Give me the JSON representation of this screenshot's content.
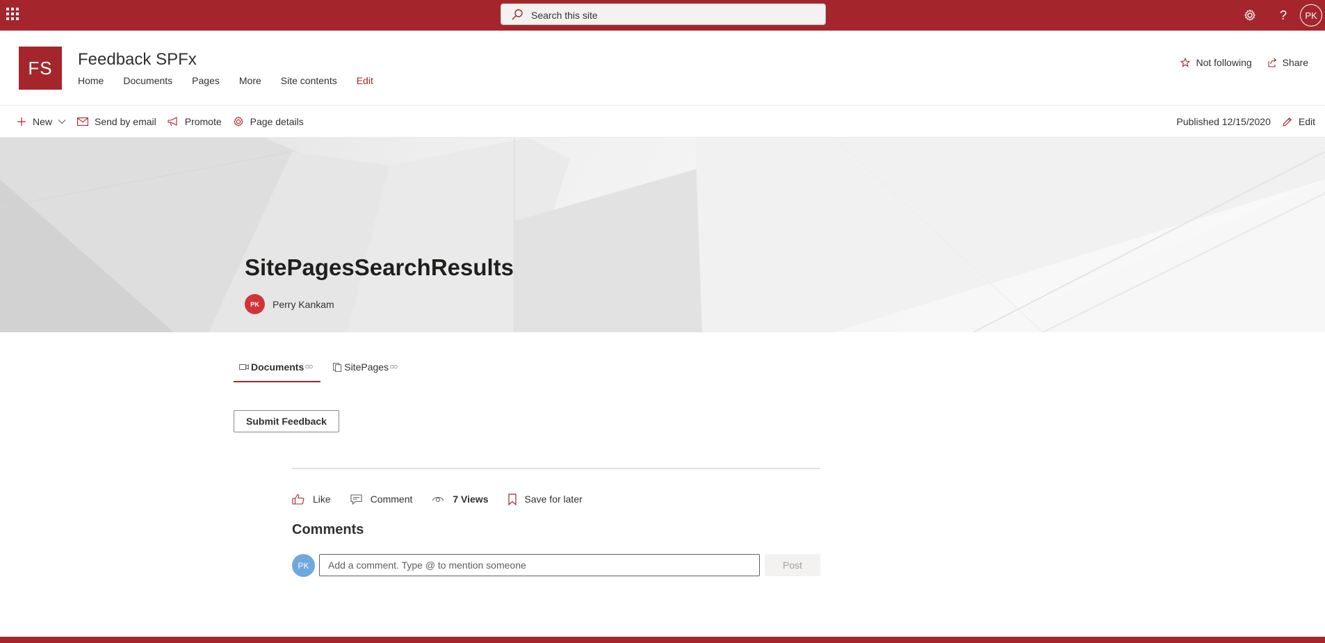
{
  "colors": {
    "theme": "#a4262c",
    "author_avatar": "#d13438",
    "user_avatar": "#6fa8dc"
  },
  "suitebar": {
    "search_placeholder": "Search this site",
    "settings_icon": "gear-icon",
    "help_label": "?",
    "user_initials": "PK"
  },
  "site": {
    "logo_initials": "FS",
    "title": "Feedback SPFx",
    "nav": [
      {
        "label": "Home"
      },
      {
        "label": "Documents"
      },
      {
        "label": "Pages"
      },
      {
        "label": "More"
      },
      {
        "label": "Site contents"
      },
      {
        "label": "Edit"
      }
    ],
    "follow_label": "Not following",
    "share_label": "Share"
  },
  "commandbar": {
    "new_label": "New",
    "send_email_label": "Send by email",
    "promote_label": "Promote",
    "page_details_label": "Page details",
    "published_label": "Published 12/15/2020",
    "edit_label": "Edit"
  },
  "page": {
    "title": "SitePagesSearchResults",
    "author_initials": "PK",
    "author_name": "Perry Kankam"
  },
  "tabs": [
    {
      "label": "Documents",
      "active": true
    },
    {
      "label": "SitePages",
      "active": false
    }
  ],
  "submit_label": "Submit Feedback",
  "social": {
    "like_label": "Like",
    "comment_label": "Comment",
    "views_label": "7 Views",
    "save_label": "Save for later"
  },
  "comments": {
    "heading": "Comments",
    "user_initials": "PK",
    "placeholder": "Add a comment. Type @ to mention someone",
    "post_label": "Post"
  }
}
